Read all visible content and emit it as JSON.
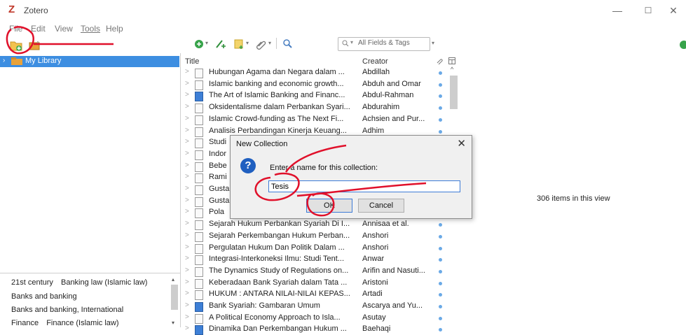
{
  "window": {
    "title": "Zotero",
    "logo": "Z",
    "minimize": "—",
    "maximize": "☐",
    "close": "✕"
  },
  "menu": [
    {
      "label": "File"
    },
    {
      "label": "Edit"
    },
    {
      "label": "View"
    },
    {
      "label": "Tools"
    },
    {
      "label": "Help"
    }
  ],
  "search": {
    "placeholder": "All Fields & Tags",
    "mode_icon": "search-icon"
  },
  "collections": {
    "library_label": "My Library"
  },
  "columns": {
    "title": "Title",
    "creator": "Creator"
  },
  "items": [
    {
      "title": "Hubungan Agama dan Negara dalam ...",
      "creator": "Abdillah",
      "type": "document"
    },
    {
      "title": "Islamic banking and economic growth...",
      "creator": "Abduh and Omar",
      "type": "document"
    },
    {
      "title": "The Art of Islamic Banking and Financ...",
      "creator": "Abdul-Rahman",
      "type": "book"
    },
    {
      "title": "Oksidentalisme dalam Perbankan Syari...",
      "creator": "Abdurahim",
      "type": "document"
    },
    {
      "title": "Islamic Crowd-funding as The Next Fi...",
      "creator": "Achsien and Pur...",
      "type": "document"
    },
    {
      "title": "Analisis Perbandingan Kinerja Keuang...",
      "creator": "Adhim",
      "type": "document"
    },
    {
      "title": "Studi",
      "creator": "",
      "type": "document"
    },
    {
      "title": "Indor",
      "creator": "",
      "type": "document"
    },
    {
      "title": "Bebe",
      "creator": "",
      "type": "document"
    },
    {
      "title": "Rami",
      "creator": "",
      "type": "document"
    },
    {
      "title": "Gusta",
      "creator": "",
      "type": "document"
    },
    {
      "title": "Gusta",
      "creator": "",
      "type": "document"
    },
    {
      "title": "Pola",
      "creator": "",
      "type": "document"
    },
    {
      "title": "Sejarah Hukum Perbankan Syariah Di I...",
      "creator": "Annisaa et al.",
      "type": "document"
    },
    {
      "title": "Sejarah Perkembangan Hukum Perban...",
      "creator": "Anshori",
      "type": "document"
    },
    {
      "title": "Pergulatan Hukum Dan Politik Dalam ...",
      "creator": "Anshori",
      "type": "document"
    },
    {
      "title": "Integrasi-Interkoneksi Ilmu: Studi Tent...",
      "creator": "Anwar",
      "type": "document"
    },
    {
      "title": "The Dynamics Study of Regulations on...",
      "creator": "Arifin and Nasuti...",
      "type": "document"
    },
    {
      "title": "Keberadaan Bank Syariah dalam Tata ...",
      "creator": "Aristoni",
      "type": "document"
    },
    {
      "title": "HUKUM : ANTARA NILAI-NILAI KEPAS...",
      "creator": "Artadi",
      "type": "document"
    },
    {
      "title": "Bank Syariah: Gambaran Umum",
      "creator": "Ascarya and Yu...",
      "type": "book"
    },
    {
      "title": "A Political Economy Approach to Isla...",
      "creator": "Asutay",
      "type": "document"
    },
    {
      "title": "Dinamika Dan Perkembangan Hukum ...",
      "creator": "Baehaqi",
      "type": "book"
    }
  ],
  "tags": [
    {
      "a": "21st century",
      "b": "Banking law (Islamic law)"
    },
    {
      "a": "Banks and banking",
      "b": ""
    },
    {
      "a": "Banks and banking, International",
      "b": ""
    },
    {
      "a": "Finance",
      "b": "Finance (Islamic law)"
    }
  ],
  "right_pane": {
    "count_text": "306 items in this view"
  },
  "dialog": {
    "title": "New Collection",
    "prompt": "Enter a name for this collection:",
    "input_value": "Tesis",
    "ok_label": "OK",
    "cancel_label": "Cancel",
    "close_glyph": "✕",
    "question_glyph": "?"
  },
  "colors": {
    "selection": "#3d8ee1",
    "annotation": "#e0102a"
  }
}
